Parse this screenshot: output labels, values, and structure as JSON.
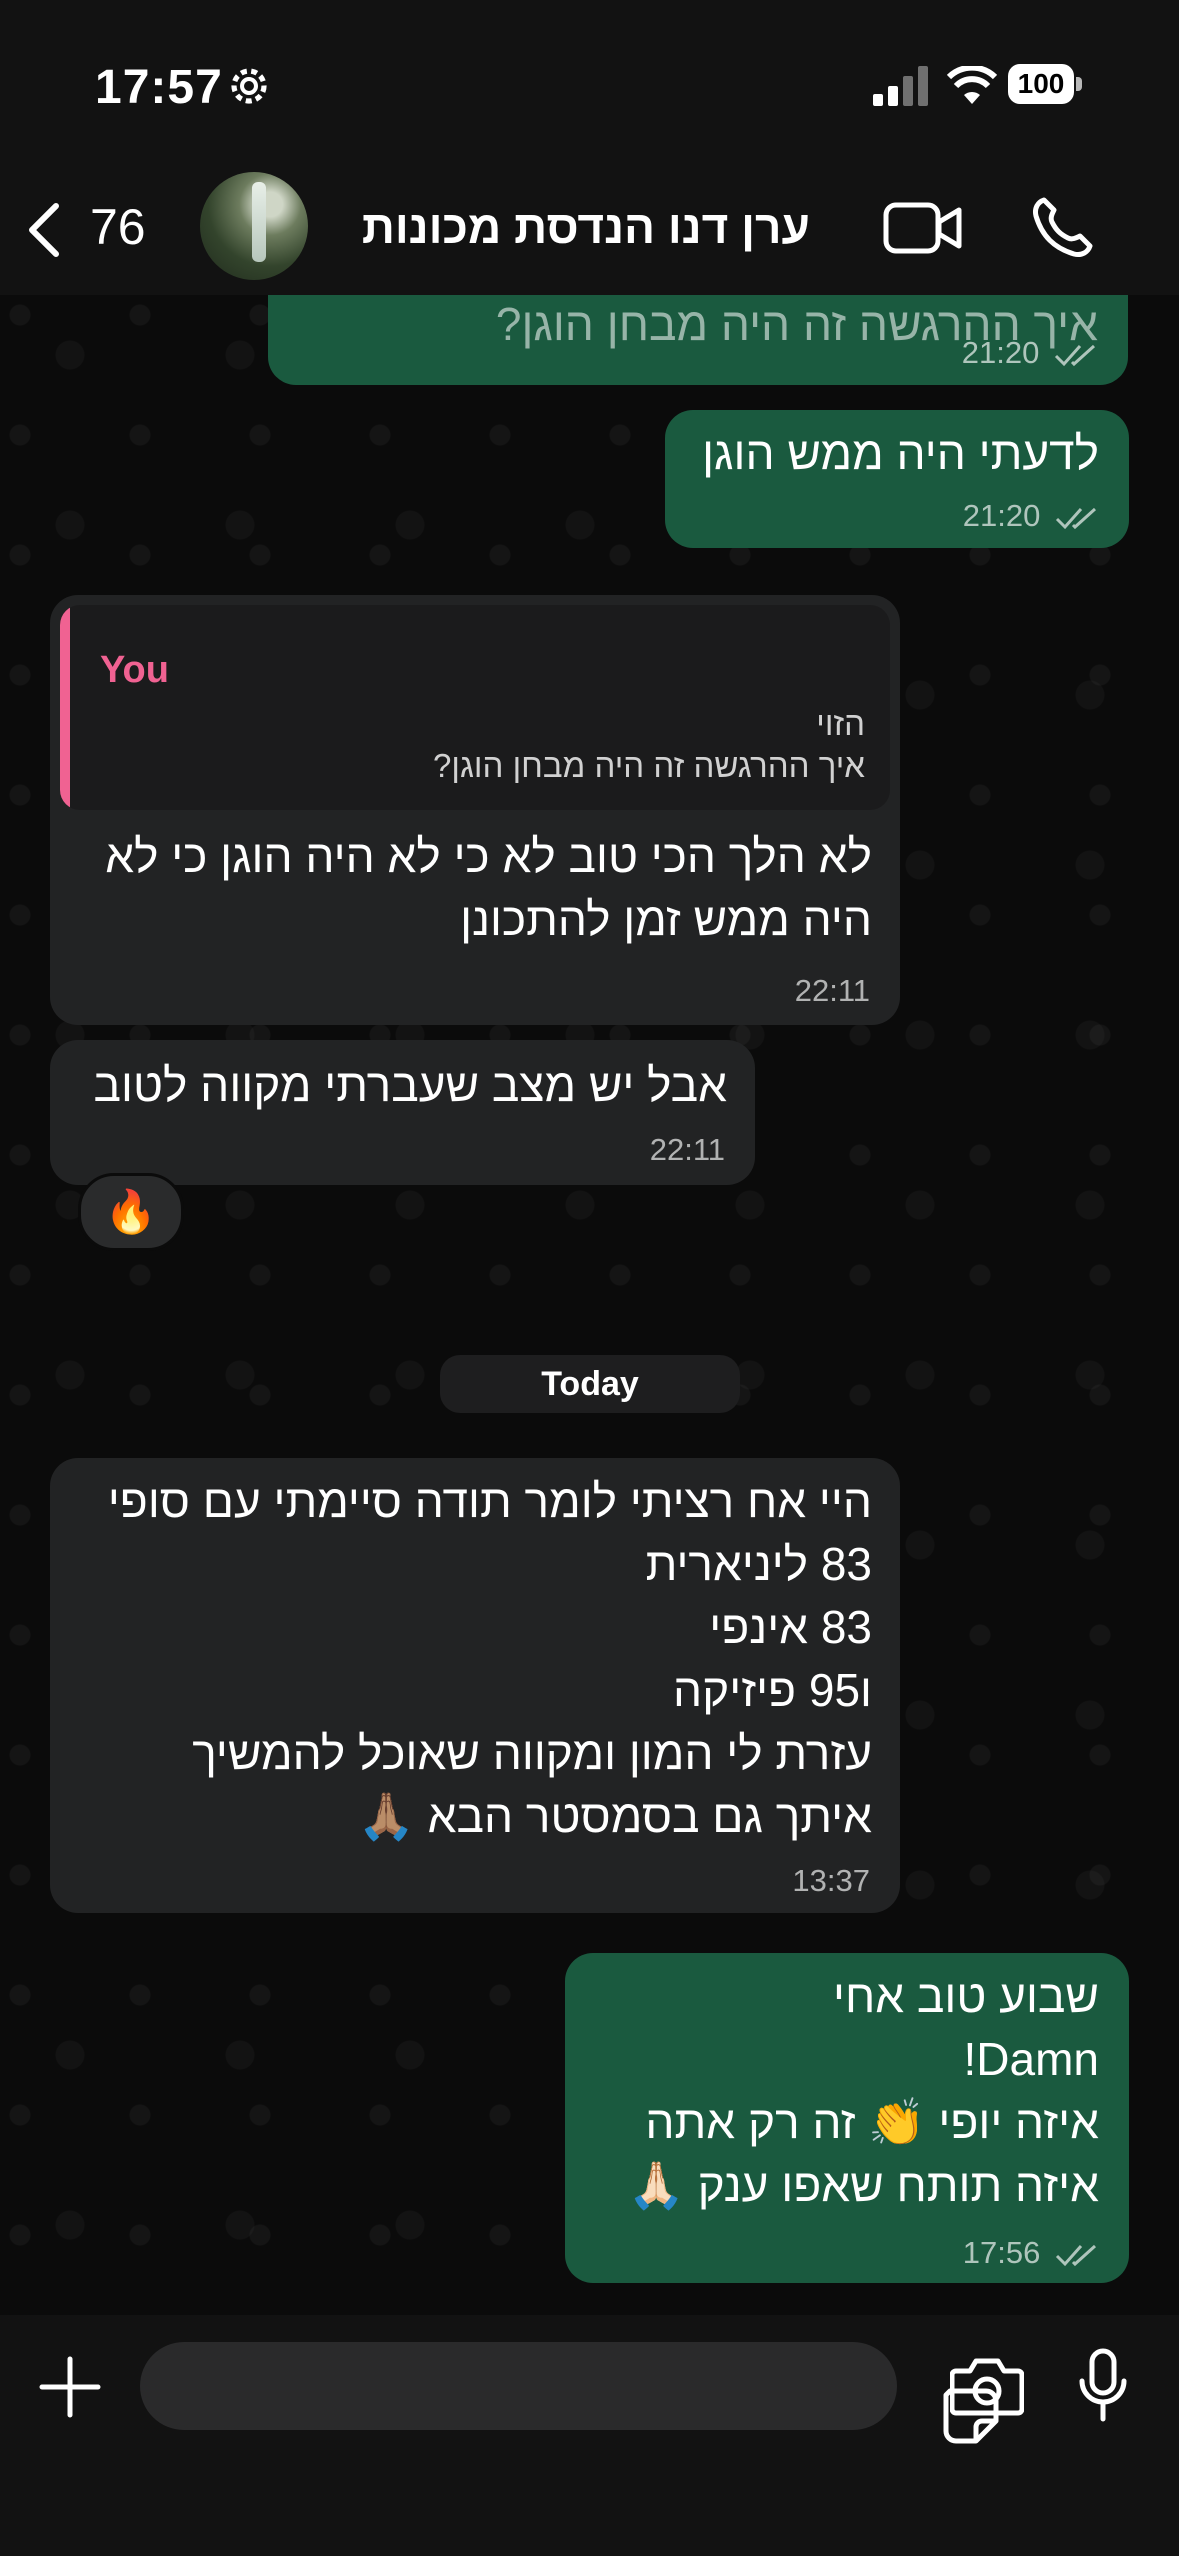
{
  "status_bar": {
    "time": "17:57",
    "battery": "100"
  },
  "header": {
    "unread_count": "76",
    "contact_name": "ערן דנו הנדסת מכונות"
  },
  "messages": [
    {
      "dir": "out",
      "text": [
        "איך ההרגשה זה היה מבחן הוגן?"
      ],
      "time": "21:20"
    },
    {
      "dir": "out",
      "text": [
        "לדעתי היה ממש הוגן"
      ],
      "time": "21:20"
    },
    {
      "dir": "in",
      "quote": {
        "author": "You",
        "lines": [
          "הזוי",
          "איך ההרגשה זה היה מבחן הוגן?"
        ]
      },
      "text": [
        "לא הלך הכי טוב לא כי לא היה הוגן כי לא",
        "היה ממש זמן להתכונן"
      ],
      "time": "22:11"
    },
    {
      "dir": "in",
      "text": [
        "אבל יש מצב שעברתי מקווה לטוב"
      ],
      "time": "22:11",
      "reaction": "🔥"
    },
    {
      "dir": "in",
      "text": [
        "היי אח רציתי לומר תודה סיימתי עם סופי",
        "83 ליניארית",
        "83 אינפי",
        "ו95 פיזיקה",
        "עזרת לי המון ומקווה שאוכל להמשיך",
        "איתך גם בסמסטר הבא 🙏🏽"
      ],
      "time": "13:37"
    },
    {
      "dir": "out",
      "text": [
        "שבוע טוב אחי",
        "Damn!",
        "איזה יופי 👏 זה רק אתה",
        "איזה תותח שאפו ענק 🙏🏻"
      ],
      "time": "17:56"
    }
  ],
  "date_divider": "Today",
  "icons": [
    "gear-icon",
    "signal-icon",
    "wifi-icon",
    "battery-icon",
    "back-chevron-icon",
    "video-call-icon",
    "phone-icon",
    "plus-icon",
    "sticker-icon",
    "camera-icon",
    "microphone-icon",
    "double-check-icon"
  ],
  "colors": {
    "outgoing": "#1a5a3f",
    "incoming": "#222324",
    "quote_accent": "#f06292",
    "background": "#0b0b0b"
  }
}
